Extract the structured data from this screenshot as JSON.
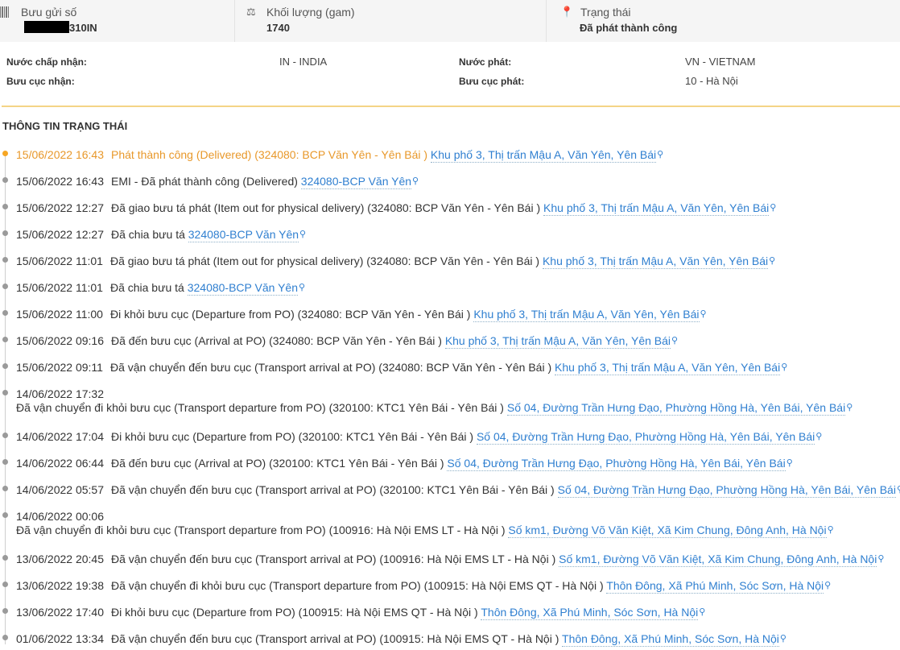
{
  "summary": {
    "tracking_label": "Bưu gửi số",
    "tracking_number_suffix": "310IN",
    "weight_label": "Khối lượng (gam)",
    "weight_value": "1740",
    "status_label": "Trạng thái",
    "status_value": "Đã phát thành công"
  },
  "info": {
    "accept_country_label": "Nước chấp nhận:",
    "accept_country_value": "IN - INDIA",
    "accept_office_label": "Bưu cục nhận:",
    "accept_office_value": "",
    "dest_country_label": "Nước phát:",
    "dest_country_value": "VN - VIETNAM",
    "dest_office_label": "Bưu cục phát:",
    "dest_office_value": "10 - Hà Nội"
  },
  "section_title": "THÔNG TIN TRẠNG THÁI",
  "events": [
    {
      "time": "15/06/2022 16:43",
      "desc": "Phát thành công (Delivered) (324080: BCP Văn Yên - Yên Bái )",
      "addr": "Khu phố 3, Thị trấn Mậu A, Văn Yên, Yên Bái"
    },
    {
      "time": "15/06/2022 16:43",
      "desc": "EMI - Đã phát thành công (Delivered)",
      "addr": "324080-BCP Văn Yên"
    },
    {
      "time": "15/06/2022 12:27",
      "desc": "Đã giao bưu tá phát (Item out for physical delivery) (324080: BCP Văn Yên - Yên Bái )",
      "addr": "Khu phố 3, Thị trấn Mậu A, Văn Yên, Yên Bái"
    },
    {
      "time": "15/06/2022 12:27",
      "desc": "Đã chia bưu tá",
      "addr": "324080-BCP Văn Yên"
    },
    {
      "time": "15/06/2022 11:01",
      "desc": "Đã giao bưu tá phát (Item out for physical delivery) (324080: BCP Văn Yên - Yên Bái )",
      "addr": "Khu phố 3, Thị trấn Mậu A, Văn Yên, Yên Bái"
    },
    {
      "time": "15/06/2022 11:01",
      "desc": "Đã chia bưu tá",
      "addr": "324080-BCP Văn Yên"
    },
    {
      "time": "15/06/2022 11:00",
      "desc": "Đi khỏi bưu cục (Departure from PO) (324080: BCP Văn Yên - Yên Bái )",
      "addr": "Khu phố 3, Thị trấn Mậu A, Văn Yên, Yên Bái"
    },
    {
      "time": "15/06/2022 09:16",
      "desc": "Đã đến bưu cục (Arrival at PO) (324080: BCP Văn Yên - Yên Bái )",
      "addr": "Khu phố 3, Thị trấn Mậu A, Văn Yên, Yên Bái"
    },
    {
      "time": "15/06/2022 09:11",
      "desc": "Đã vận chuyển đến bưu cục (Transport arrival at PO) (324080: BCP Văn Yên - Yên Bái )",
      "addr": "Khu phố 3, Thị trấn Mậu A, Văn Yên, Yên Bái"
    },
    {
      "time": "14/06/2022 17:32",
      "desc": "Đã vận chuyển đi khỏi bưu cục (Transport departure from PO) (320100: KTC1 Yên Bái - Yên Bái )",
      "addr": "Số 04, Đường Trần Hưng Đạo, Phường Hồng Hà, Yên Bái, Yên Bái"
    },
    {
      "time": "14/06/2022 17:04",
      "desc": "Đi khỏi bưu cục (Departure from PO) (320100: KTC1 Yên Bái - Yên Bái )",
      "addr": "Số 04, Đường Trần Hưng Đạo, Phường Hồng Hà, Yên Bái, Yên Bái"
    },
    {
      "time": "14/06/2022 06:44",
      "desc": "Đã đến bưu cục (Arrival at PO) (320100: KTC1 Yên Bái - Yên Bái )",
      "addr": "Số 04, Đường Trần Hưng Đạo, Phường Hồng Hà, Yên Bái, Yên Bái"
    },
    {
      "time": "14/06/2022 05:57",
      "desc": "Đã vận chuyển đến bưu cục (Transport arrival at PO) (320100: KTC1 Yên Bái - Yên Bái )",
      "addr": "Số 04, Đường Trần Hưng Đạo, Phường Hồng Hà, Yên Bái, Yên Bái"
    },
    {
      "time": "14/06/2022 00:06",
      "desc": "Đã vận chuyển đi khỏi bưu cục (Transport departure from PO) (100916: Hà Nội EMS LT - Hà Nội )",
      "addr": "Số km1, Đường Võ Văn Kiệt, Xã Kim Chung, Đông Anh, Hà Nội"
    },
    {
      "time": "13/06/2022 20:45",
      "desc": "Đã vận chuyển đến bưu cục (Transport arrival at PO) (100916: Hà Nội EMS LT - Hà Nội )",
      "addr": "Số km1, Đường Võ Văn Kiệt, Xã Kim Chung, Đông Anh, Hà Nội"
    },
    {
      "time": "13/06/2022 19:38",
      "desc": "Đã vận chuyển đi khỏi bưu cục (Transport departure from PO) (100915: Hà Nội EMS QT - Hà Nội )",
      "addr": "Thôn Đông, Xã Phú Minh, Sóc Sơn, Hà Nội"
    },
    {
      "time": "13/06/2022 17:40",
      "desc": "Đi khỏi bưu cục (Departure from PO) (100915: Hà Nội EMS QT - Hà Nội )",
      "addr": "Thôn Đông, Xã Phú Minh, Sóc Sơn, Hà Nội"
    },
    {
      "time": "01/06/2022 13:34",
      "desc": "Đã vận chuyển đến bưu cục (Transport arrival at PO) (100915: Hà Nội EMS QT - Hà Nội )",
      "addr": "Thôn Đông, Xã Phú Minh, Sóc Sơn, Hà Nội"
    }
  ],
  "icons": {
    "pin": "map-pin-icon",
    "scale": "scale-icon",
    "barcode": "barcode-icon",
    "location": "location-icon"
  },
  "colors": {
    "accent": "#e8982a",
    "link": "#2f7fd0",
    "divider": "#f4d486"
  }
}
